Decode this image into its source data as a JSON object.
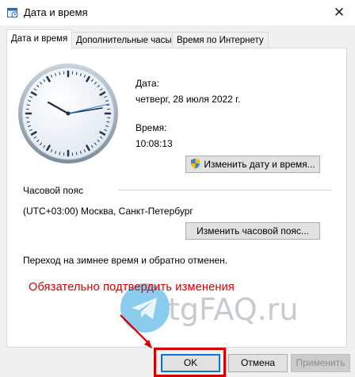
{
  "window": {
    "title": "Дата и время",
    "close_glyph": "✕"
  },
  "tabs": [
    {
      "label": "Дата и время",
      "active": true
    },
    {
      "label": "Дополнительные часы",
      "active": false
    },
    {
      "label": "Время по Интернету",
      "active": false
    }
  ],
  "datetime": {
    "date_label": "Дата:",
    "date_value": "четверг, 28 июля 2022 г.",
    "time_label": "Время:",
    "time_value": "10:08:13",
    "change_datetime_button": "Изменить дату и время..."
  },
  "timezone": {
    "section_label": "Часовой пояс",
    "value": "(UTC+03:00) Москва, Санкт-Петербург",
    "change_timezone_button": "Изменить часовой пояс...",
    "dst_note": "Переход на зимнее время и обратно отменен."
  },
  "annotation": {
    "text": "Обязательно подтвердить изменения",
    "color": "#d00000"
  },
  "watermark": {
    "text": "tgFAQ.ru"
  },
  "footer": {
    "ok": "OK",
    "cancel": "Отмена",
    "apply": "Применить"
  },
  "icons": {
    "window": "calendar-clock-icon",
    "shield": "uac-shield-icon"
  },
  "colors": {
    "accent": "#0078d7",
    "annotation": "#d40000"
  }
}
